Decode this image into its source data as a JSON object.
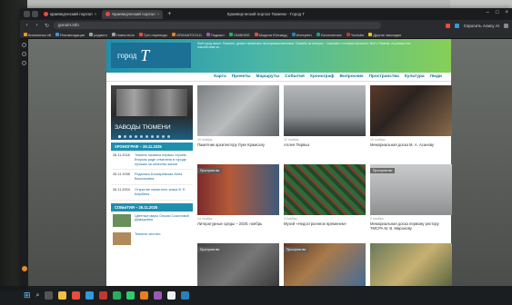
{
  "window": {
    "title": "Краеведческий портал Тюмени - Город Т",
    "tabs": [
      {
        "label": "краеведческий портал"
      },
      {
        "label": "Краеведческий портал"
      }
    ]
  },
  "address_bar": {
    "url": "gorod-t.info",
    "right_text": "Спросить Алису AI"
  },
  "bookmarks": [
    "Кинопоиск нtf",
    "Рекомендации",
    "редакто",
    "Новостное",
    "Гугл переводч",
    "GRANATGOLD",
    "Подкаст",
    "GMBOBS",
    "Модели Юлимуд",
    "Интернет",
    "Бесплатные",
    "Youtube",
    "Другие закладки"
  ],
  "site": {
    "logo_text": "город",
    "logo_mark": "Т",
    "quote": "Мой город пишет. Помните, деньги тюменских лесопромышленников. Спасибо за интерес... сожалеет о потерях прошлого. Всё о Тюмени, из разных лет, спасибо вам за...",
    "menu": [
      "Карта",
      "Проекты",
      "Маршруты",
      "События",
      "Хронограф",
      "Вопросник",
      "Пространства",
      "Культура",
      "Люди"
    ],
    "hero_title": "ЗАВОДЫ ТЮМЕНИ",
    "chronograph": {
      "header": "ХРОНОГРАФ – 26.11.2025",
      "items": [
        {
          "date": "26.11.2018",
          "text": "Тюмень назвала первых героем. Вторым ряде отмечена в городе лучшим за качество жизни"
        },
        {
          "date": "26.11.1938",
          "text": "Родилась Бочкарёвская Анна Васильевна"
        },
        {
          "date": "26.11.2004",
          "text": "Открытие памятного знака В. Е. Шарбиля"
        }
      ]
    },
    "events": {
      "header": "СОБЫТИЯ – 26.11.2025",
      "items": [
        {
          "text": "Цветные миры Ольмы Соколовой Демидовна"
        },
        {
          "text": "Тюмени чистить"
        }
      ]
    },
    "cards": [
      {
        "date": "29 ноября",
        "title": "Памятник архитектору Луке Крамсалу",
        "tag": ""
      },
      {
        "date": "22 ноября",
        "title": "Аллея Первых",
        "tag": ""
      },
      {
        "date": "16 ноября",
        "title": "Мемориальная доска М. А. Асанову",
        "tag": ""
      },
      {
        "date": "14 ноября",
        "title": "Литературные среды – 2025: ноябрь",
        "tag": "Пространство"
      },
      {
        "date": "3 ноября",
        "title": "Музей «Недостроенное временем»",
        "tag": ""
      },
      {
        "date": "2 ноября",
        "title": "Мемориальная доска первому ректору ТМСРА М. В. Миронову",
        "tag": "Пространство"
      },
      {
        "date": "",
        "title": "",
        "tag": "Пространство"
      },
      {
        "date": "",
        "title": "",
        "tag": "Пространство"
      },
      {
        "date": "",
        "title": "",
        "tag": ""
      }
    ]
  }
}
